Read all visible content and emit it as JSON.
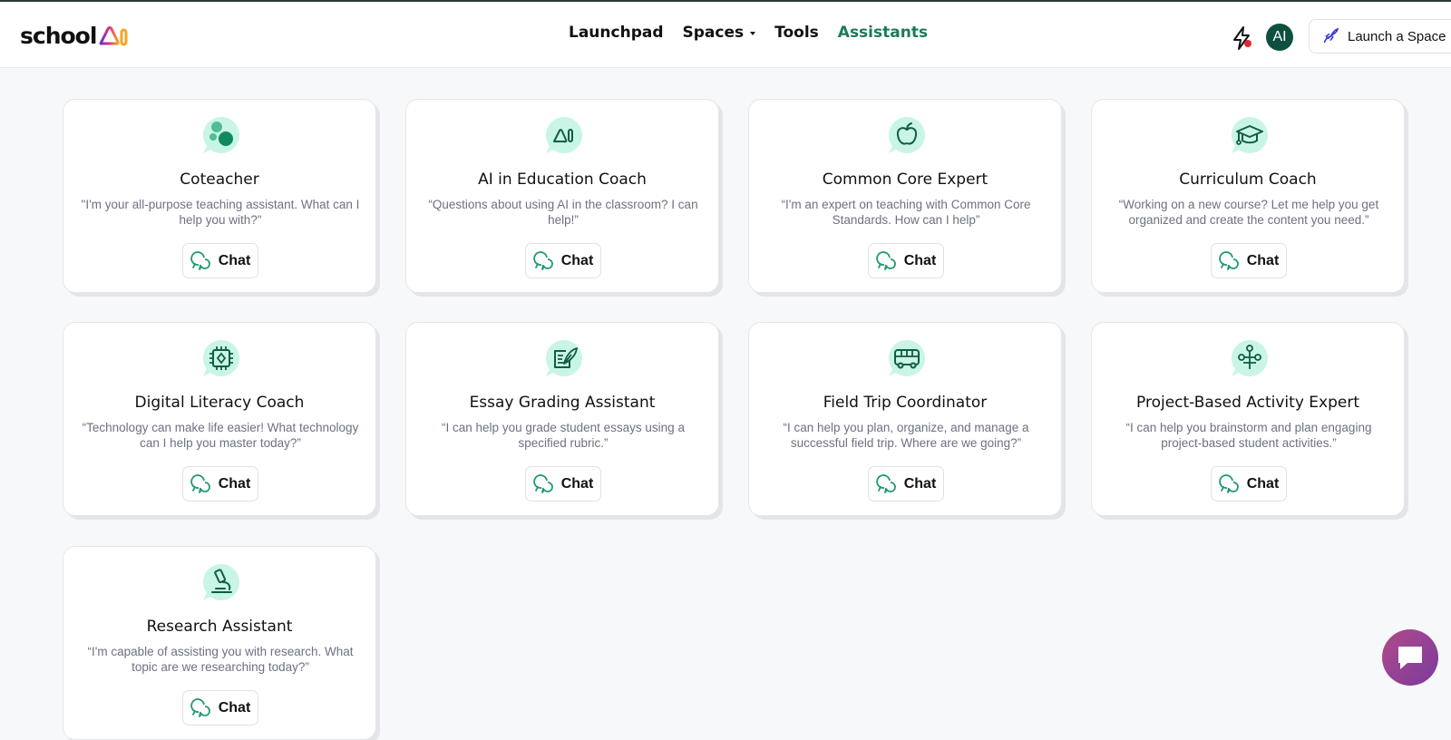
{
  "brand": {
    "logo_text": "school"
  },
  "nav": [
    {
      "label": "Launchpad",
      "active": false
    },
    {
      "label": "Spaces",
      "active": false,
      "dropdown": true
    },
    {
      "label": "Tools",
      "active": false
    },
    {
      "label": "Assistants",
      "active": true
    }
  ],
  "header": {
    "avatar_initials": "AI",
    "launch_label": "Launch a Space"
  },
  "colors": {
    "accent": "#1d7a58",
    "icon_bg": "#c9f5e6",
    "notification": "#e4262b",
    "avatar_bg": "#0f4f3f"
  },
  "assistants": [
    {
      "title": "Coteacher",
      "description": "\"I'm your all-purpose teaching assistant. What can I help you with?\"",
      "button": "Chat",
      "icon": "bubbles-icon"
    },
    {
      "title": "AI in Education Coach",
      "description": "“Questions about using AI in the classroom? I can help!”",
      "button": "Chat",
      "icon": "ai-logo-icon"
    },
    {
      "title": "Common Core Expert",
      "description": "“I'm an expert on teaching with Common Core Standards. How can I help”",
      "button": "Chat",
      "icon": "apple-icon"
    },
    {
      "title": "Curriculum Coach",
      "description": "“Working on a new course? Let me help you get organized and create the content you need.”",
      "button": "Chat",
      "icon": "graduation-cap-icon"
    },
    {
      "title": "Digital Literacy Coach",
      "description": "“Technology can make life easier! What technology can I help you master today?”",
      "button": "Chat",
      "icon": "cpu-chip-icon"
    },
    {
      "title": "Essay Grading Assistant",
      "description": "“I can help you grade student essays using a specified rubric.”",
      "button": "Chat",
      "icon": "quill-paper-icon"
    },
    {
      "title": "Field Trip Coordinator",
      "description": "“I can help you plan, organize, and manage a successful field trip. Where are we going?”",
      "button": "Chat",
      "icon": "bus-icon"
    },
    {
      "title": "Project-Based Activity Expert",
      "description": "“I can help you brainstorm and plan engaging project-based student activities.”",
      "button": "Chat",
      "icon": "network-icon"
    },
    {
      "title": "Research Assistant",
      "description": "“I'm capable of assisting you with research. What topic are we researching today?”",
      "button": "Chat",
      "icon": "microscope-icon"
    }
  ]
}
